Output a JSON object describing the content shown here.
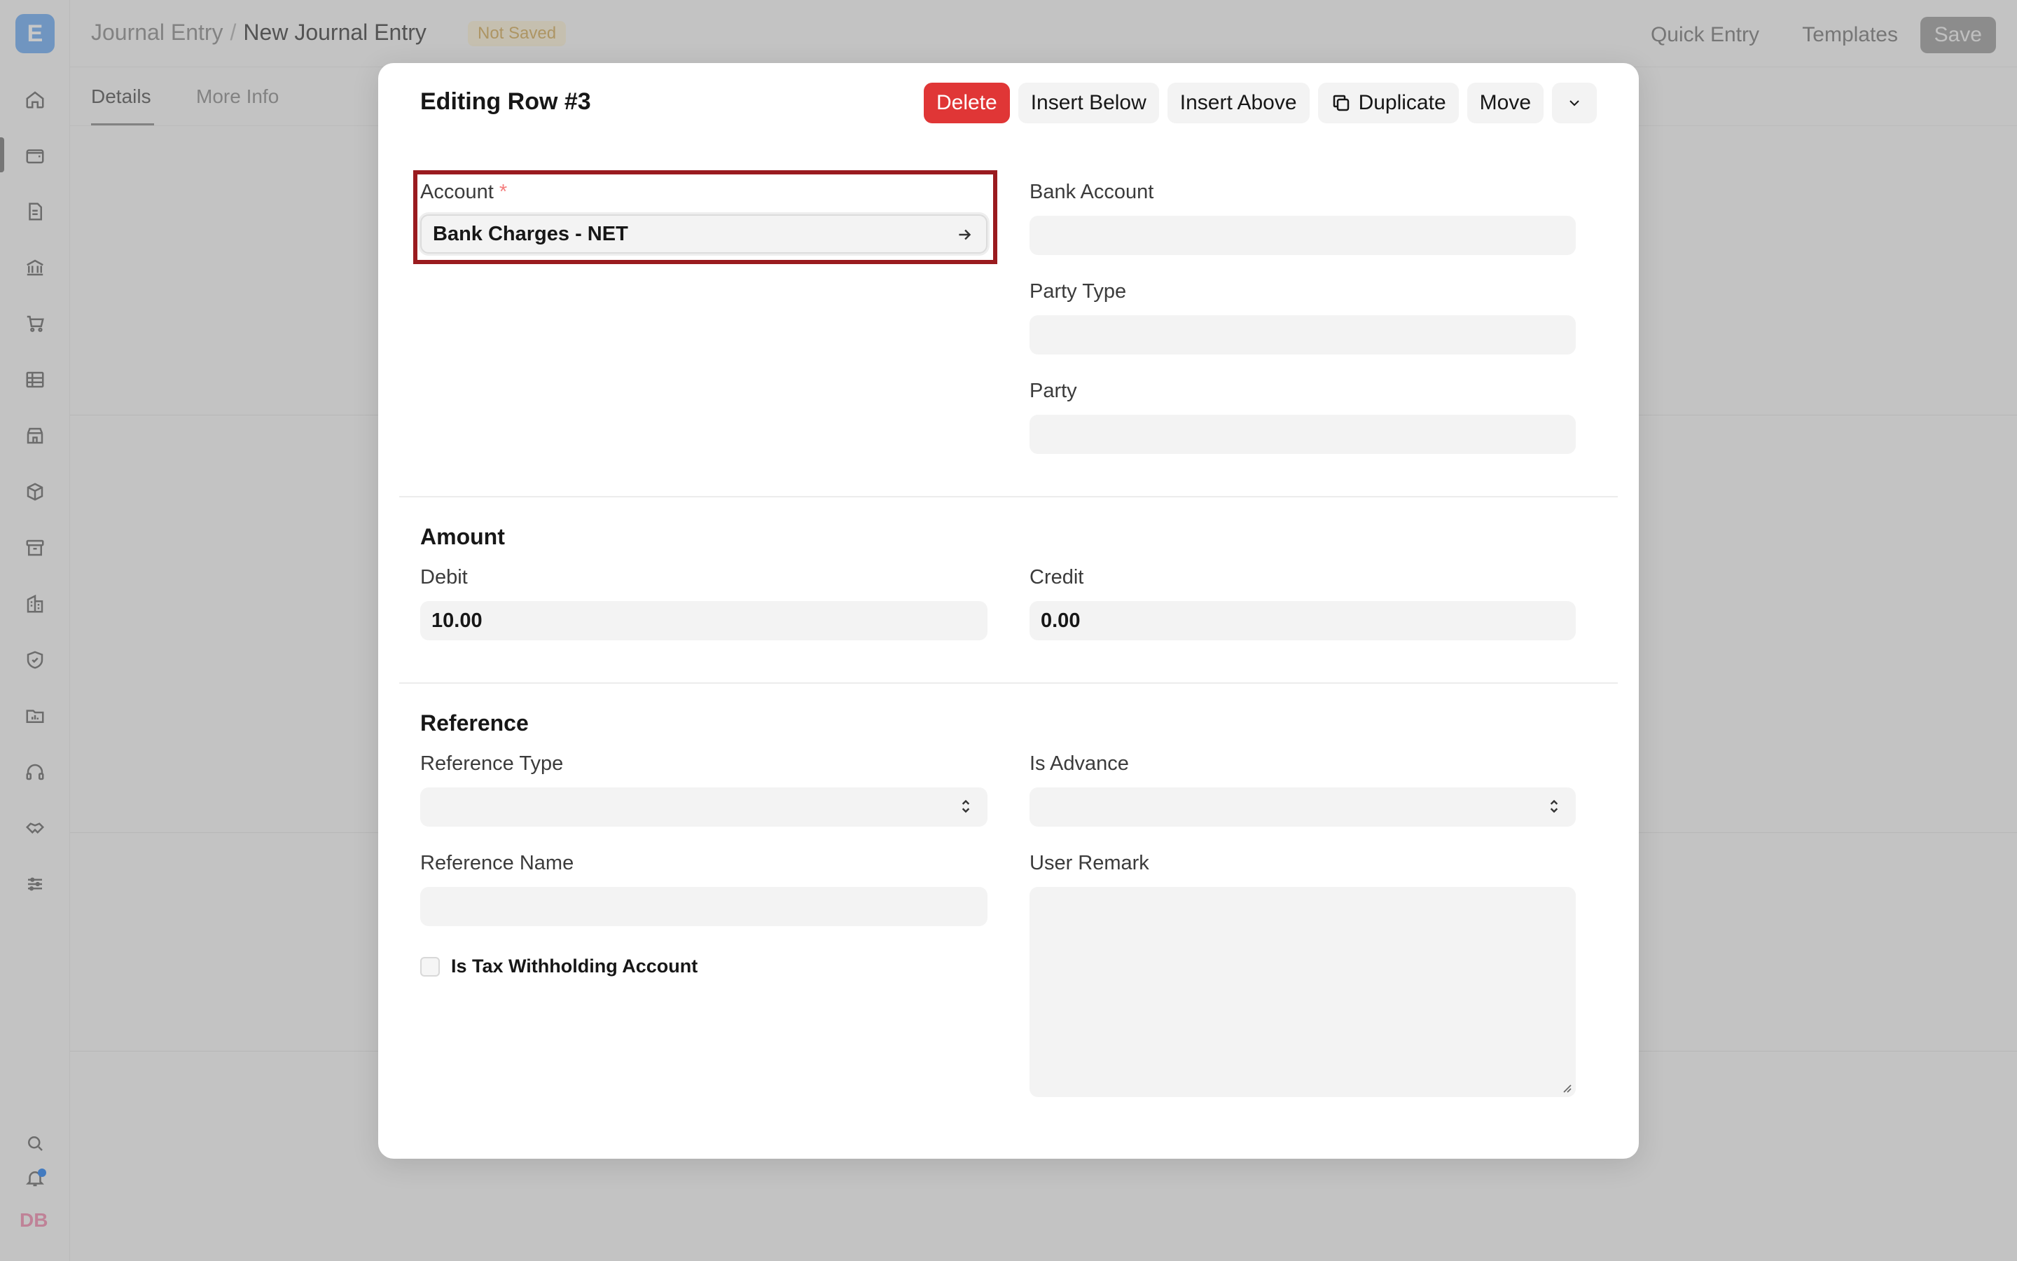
{
  "app": {
    "logo_letter": "E",
    "avatar_initials": "DB",
    "breadcrumb": {
      "parent": "Journal Entry",
      "separator": "/",
      "current": "New Journal Entry"
    },
    "status_badge": "Not Saved",
    "top_actions": {
      "quick_entry": "Quick Entry",
      "templates": "Templates",
      "save": "Save"
    },
    "tabs": [
      {
        "label": "Details"
      },
      {
        "label": "More Info"
      }
    ],
    "sidebar_icons": [
      "home-icon",
      "wallet-icon",
      "file-icon",
      "bank-icon",
      "cart-icon",
      "table-icon",
      "store-icon",
      "box-icon",
      "archive-icon",
      "building-icon",
      "shield-icon",
      "folder-chart-icon",
      "headset-icon",
      "handshake-icon",
      "sliders-icon",
      "search-icon",
      "bell-icon"
    ]
  },
  "modal": {
    "title": "Editing Row #3",
    "actions": {
      "delete": "Delete",
      "insert_below": "Insert Below",
      "insert_above": "Insert Above",
      "duplicate": "Duplicate",
      "move": "Move"
    },
    "account": {
      "label": "Account",
      "required_mark": "*",
      "value": "Bank Charges - NET"
    },
    "bank_account": {
      "label": "Bank Account",
      "value": ""
    },
    "party_type": {
      "label": "Party Type",
      "value": ""
    },
    "party": {
      "label": "Party",
      "value": ""
    },
    "amount_section": {
      "title": "Amount",
      "debit": {
        "label": "Debit",
        "value": "10.00"
      },
      "credit": {
        "label": "Credit",
        "value": "0.00"
      }
    },
    "reference_section": {
      "title": "Reference",
      "reference_type": {
        "label": "Reference Type",
        "value": ""
      },
      "is_advance": {
        "label": "Is Advance",
        "value": ""
      },
      "reference_name": {
        "label": "Reference Name",
        "value": ""
      },
      "user_remark": {
        "label": "User Remark",
        "value": ""
      },
      "is_tax_withholding": {
        "label": "Is Tax Withholding Account",
        "checked": false
      }
    }
  },
  "colors": {
    "danger": "#e03636",
    "highlight_border": "#9a1b1f",
    "logo_bg": "#7fb6f5"
  }
}
